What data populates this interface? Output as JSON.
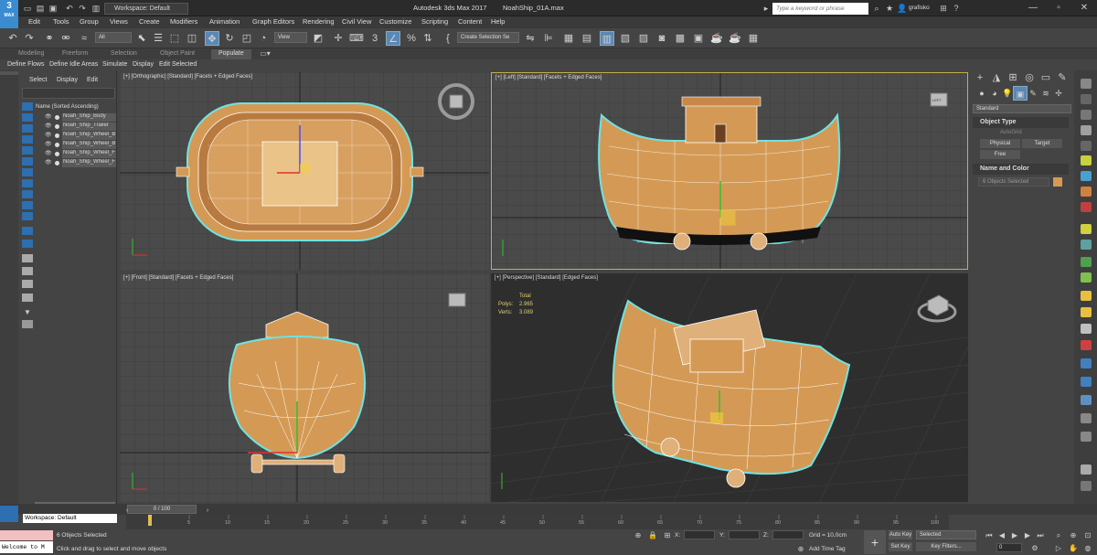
{
  "app": {
    "logo": "3",
    "logo_sub": "MAX",
    "window_title": "Autodesk 3ds Max 2017",
    "file_name": "NoahShip_01A.max",
    "workspace": "Workspace: Default",
    "search_placeholder": "Type a keyword or phrase",
    "user": "grafisko"
  },
  "menu": [
    "Edit",
    "Tools",
    "Group",
    "Views",
    "Create",
    "Modifiers",
    "Animation",
    "Graph Editors",
    "Rendering",
    "Civil View",
    "Customize",
    "Scripting",
    "Content",
    "Help"
  ],
  "toolbar": {
    "selection_filter": "All",
    "reference_coord": "View",
    "named_selection": "Create Selection Se",
    "snap_label": "3"
  },
  "ribbon": {
    "tabs": [
      "Modeling",
      "Freeform",
      "Selection",
      "Object Paint",
      "Populate"
    ],
    "active_tab": "Populate",
    "sub_items": [
      "Define Flows",
      "Define Idle Areas",
      "Simulate",
      "Display",
      "Edit Selected"
    ]
  },
  "scene_explorer": {
    "tabs": [
      "Select",
      "Display",
      "Edit"
    ],
    "header": "Name (Sorted Ascending)",
    "objects": [
      "Noah_Ship_Body",
      "Noah_Ship_Trailer",
      "Noah_Ship_Wheel_B",
      "Noah_Ship_Wheel_B",
      "Noah_Ship_Wheel_F",
      "Noah_Ship_Wheel_F"
    ]
  },
  "viewports": {
    "top_left": "[+] [Orthographic] [Standard] [Facets + Edged Faces]",
    "top_right": "[+] [Left] [Standard] [Facets + Edged Faces]",
    "bottom_left": "[+] [Front] [Standard] [Facets + Edged Faces]",
    "bottom_right": "[+] [Perspective] [Standard] [Edged Faces]",
    "cube_label": "LEFT",
    "stats": {
      "total_label": "Total",
      "polys_label": "Polys:",
      "polys_value": "2.965",
      "verts_label": "Verts:",
      "verts_value": "3.089"
    }
  },
  "command_panel": {
    "category": "Standard",
    "object_type_title": "Object Type",
    "autogrid": "AutoGrid",
    "buttons": [
      "Physical",
      "Target",
      "Free"
    ],
    "name_color_title": "Name and Color",
    "name_value": "6 Objects Selected",
    "object_color": "#d49a55"
  },
  "timeline": {
    "frame_display": "0 / 100",
    "ticks": [
      "0",
      "5",
      "10",
      "15",
      "20",
      "25",
      "30",
      "35",
      "40",
      "45",
      "50",
      "55",
      "60",
      "65",
      "70",
      "75",
      "80",
      "85",
      "90",
      "95",
      "100"
    ]
  },
  "status": {
    "workspace_label": "Workspace: Default",
    "listener": "Welcome to M",
    "selection": "6 Objects Selected",
    "prompt": "Click and drag to select and move objects",
    "x_label": "X:",
    "y_label": "Y:",
    "z_label": "Z:",
    "grid": "Grid = 10,0cm",
    "add_time_tag": "Add Time Tag",
    "auto_key": "Auto Key",
    "set_key": "Set Key",
    "selected": "Selected",
    "key_filters": "Key Filters...",
    "frame": "0"
  },
  "colors": {
    "accent_blue": "#5b87b5",
    "hull": "#d49a55",
    "wire": "#ffffff",
    "select_outline": "#6fe3e3",
    "active_viewport": "#c5b34a"
  }
}
